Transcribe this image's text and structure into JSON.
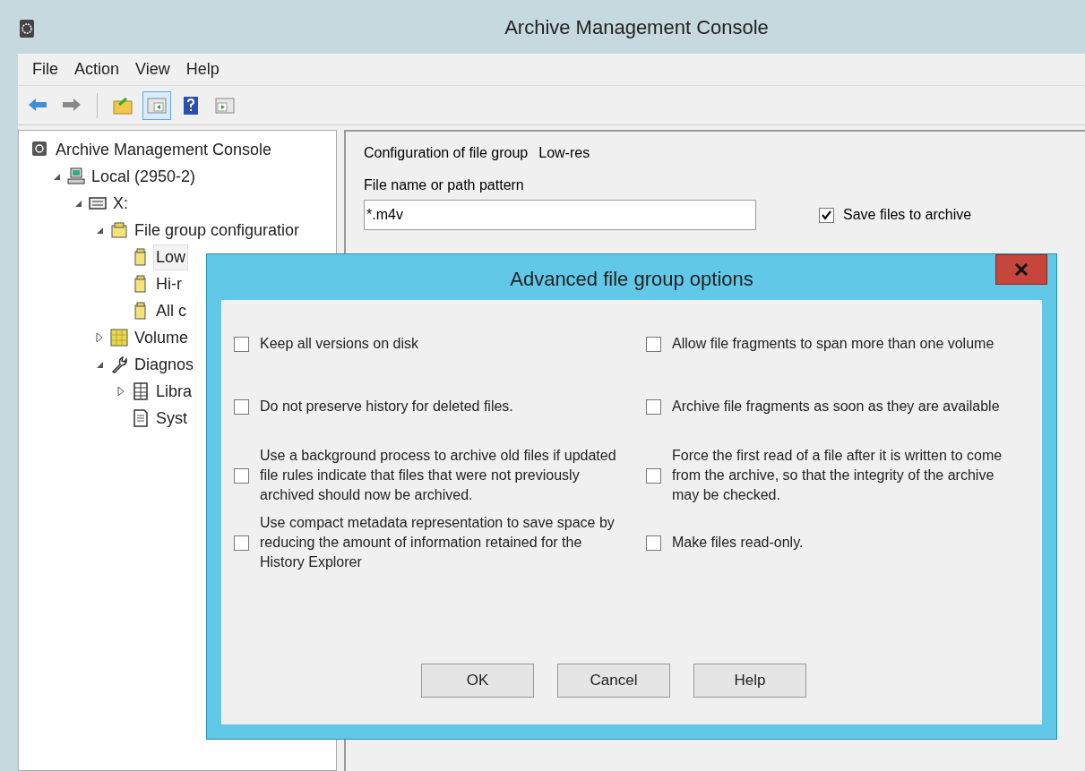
{
  "window": {
    "title": "Archive Management Console"
  },
  "menu": [
    "File",
    "Action",
    "View",
    "Help"
  ],
  "toolbar": [
    {
      "kind": "back",
      "selected": false
    },
    {
      "kind": "forward",
      "selected": false
    },
    {
      "kind": "up",
      "selected": false
    },
    {
      "kind": "pane",
      "selected": true
    },
    {
      "kind": "help",
      "selected": false
    },
    {
      "kind": "pane2",
      "selected": false
    }
  ],
  "tree": [
    {
      "label": "Archive Management Console",
      "kind": "console",
      "children": [
        {
          "label": "Local (2950-2)",
          "kind": "computer",
          "expanded": true,
          "children": [
            {
              "label": "X:",
              "kind": "drive",
              "expanded": true,
              "children": [
                {
                  "label": "File group configuratior",
                  "kind": "groups",
                  "expanded": true,
                  "children": [
                    {
                      "label": "Low",
                      "kind": "group",
                      "selected": true
                    },
                    {
                      "label": "Hi-r",
                      "kind": "group",
                      "selected": false
                    },
                    {
                      "label": "All c",
                      "kind": "group",
                      "selected": false
                    }
                  ]
                },
                {
                  "label": "Volume",
                  "kind": "volume",
                  "expanded": false
                },
                {
                  "label": "Diagnos",
                  "kind": "wrench",
                  "expanded": true,
                  "children": [
                    {
                      "label": "Libra",
                      "kind": "table",
                      "expanded": false
                    },
                    {
                      "label": "Syst",
                      "kind": "doc"
                    }
                  ]
                }
              ]
            }
          ]
        }
      ]
    }
  ],
  "config": {
    "heading": "Configuration of file group",
    "group_name": "Low-res",
    "pattern_label": "File name or path pattern",
    "pattern_value": "*.m4v",
    "save_files": {
      "label": "Save files to archive",
      "checked": true
    }
  },
  "dialog": {
    "title": "Advanced file group options",
    "left_options": [
      {
        "label": "Keep all versions on disk",
        "checked": false
      },
      {
        "label": "Do not preserve history for deleted files.",
        "checked": false
      },
      {
        "label": "Use a background process to archive old files if updated file rules indicate that files that were not previously archived should now be archived.",
        "checked": false
      },
      {
        "label": "Use compact metadata representation to save space by reducing the amount of information retained for the History Explorer",
        "checked": false
      }
    ],
    "right_options": [
      {
        "label": "Allow file fragments to span more than one volume",
        "checked": false
      },
      {
        "label": "Archive file fragments as soon as they are available",
        "checked": false
      },
      {
        "label": "Force the first read of a file after it is written to come from the archive, so that the integrity of the archive may be checked.",
        "checked": false
      },
      {
        "label": "Make files read-only.",
        "checked": false
      }
    ],
    "buttons": [
      "OK",
      "Cancel",
      "Help"
    ]
  }
}
